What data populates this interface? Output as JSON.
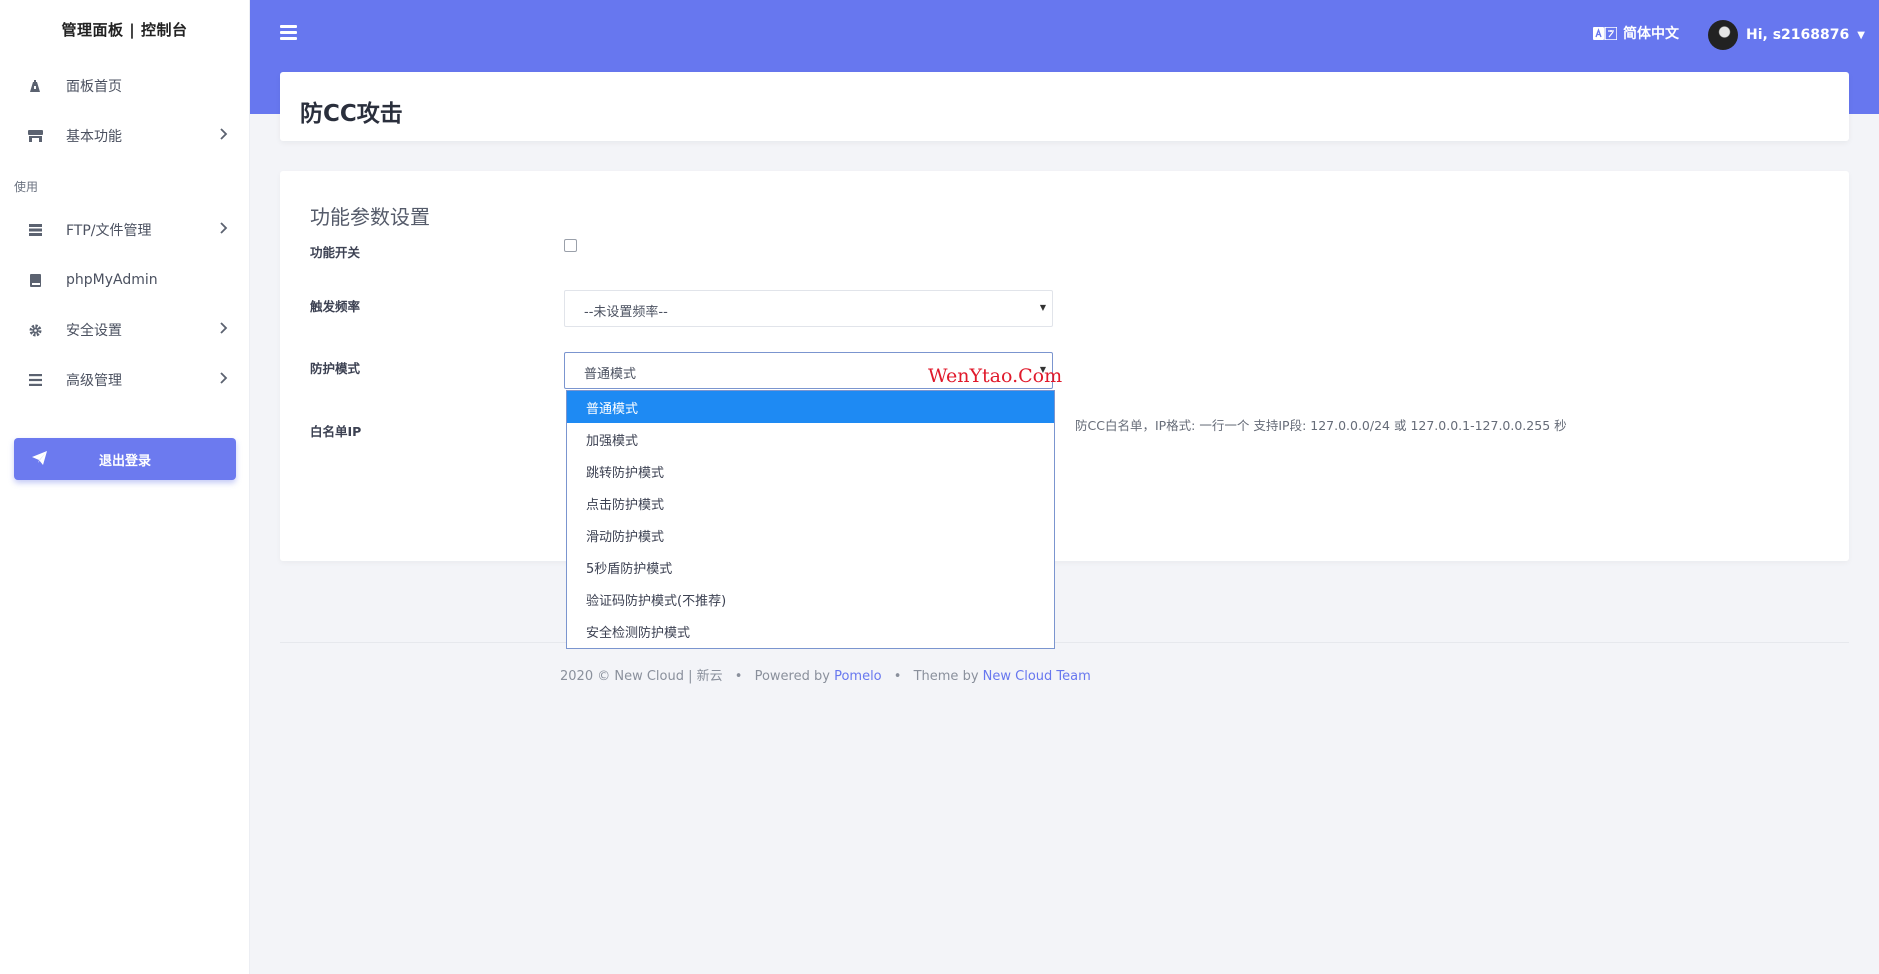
{
  "sidebar": {
    "brand": "管理面板 | 控制台",
    "items": [
      {
        "label": "面板首页",
        "icon": "tachometer-icon"
      },
      {
        "label": "基本功能",
        "icon": "store-icon",
        "has_submenu": true
      },
      {
        "label": "FTP/文件管理",
        "icon": "server-icon",
        "has_submenu": true
      },
      {
        "label": "phpMyAdmin",
        "icon": "book-icon"
      },
      {
        "label": "安全设置",
        "icon": "gear-icon",
        "has_submenu": true
      },
      {
        "label": "高级管理",
        "icon": "list-icon",
        "has_submenu": true
      }
    ],
    "section_label": "使用",
    "logout_label": "退出登录"
  },
  "topbar": {
    "language": "简体中文",
    "greeting": "Hi, s2168876"
  },
  "page": {
    "title": "防CC攻击"
  },
  "form": {
    "section_title": "功能参数设置",
    "switch_label": "功能开关",
    "switch_checked": false,
    "frequency_label": "触发频率",
    "frequency_value": "--未设置频率--",
    "mode_label": "防护模式",
    "mode_value": "普通模式",
    "whitelist_label": "白名单IP",
    "whitelist_help": "防CC白名单，IP格式: 一行一个 支持IP段: 127.0.0.0/24 或 127.0.0.1-127.0.0.255 秒"
  },
  "dropdown": {
    "selected_index": 0,
    "options": [
      "普通模式",
      "加强模式",
      "跳转防护模式",
      "点击防护模式",
      "滑动防护模式",
      "5秒盾防护模式",
      "验证码防护模式(不推荐)",
      "安全检测防护模式"
    ]
  },
  "watermark": "WenYtao.Com",
  "footer": {
    "copyright": "2020 © New Cloud | 新云",
    "powered_by": "Powered by",
    "powered_link": "Pomelo",
    "theme_by": "Theme by",
    "theme_link": "New Cloud Team",
    "separator": "•"
  },
  "colors": {
    "primary": "#6777ef",
    "selected_option": "#1e8af3",
    "watermark": "#e0192b"
  }
}
